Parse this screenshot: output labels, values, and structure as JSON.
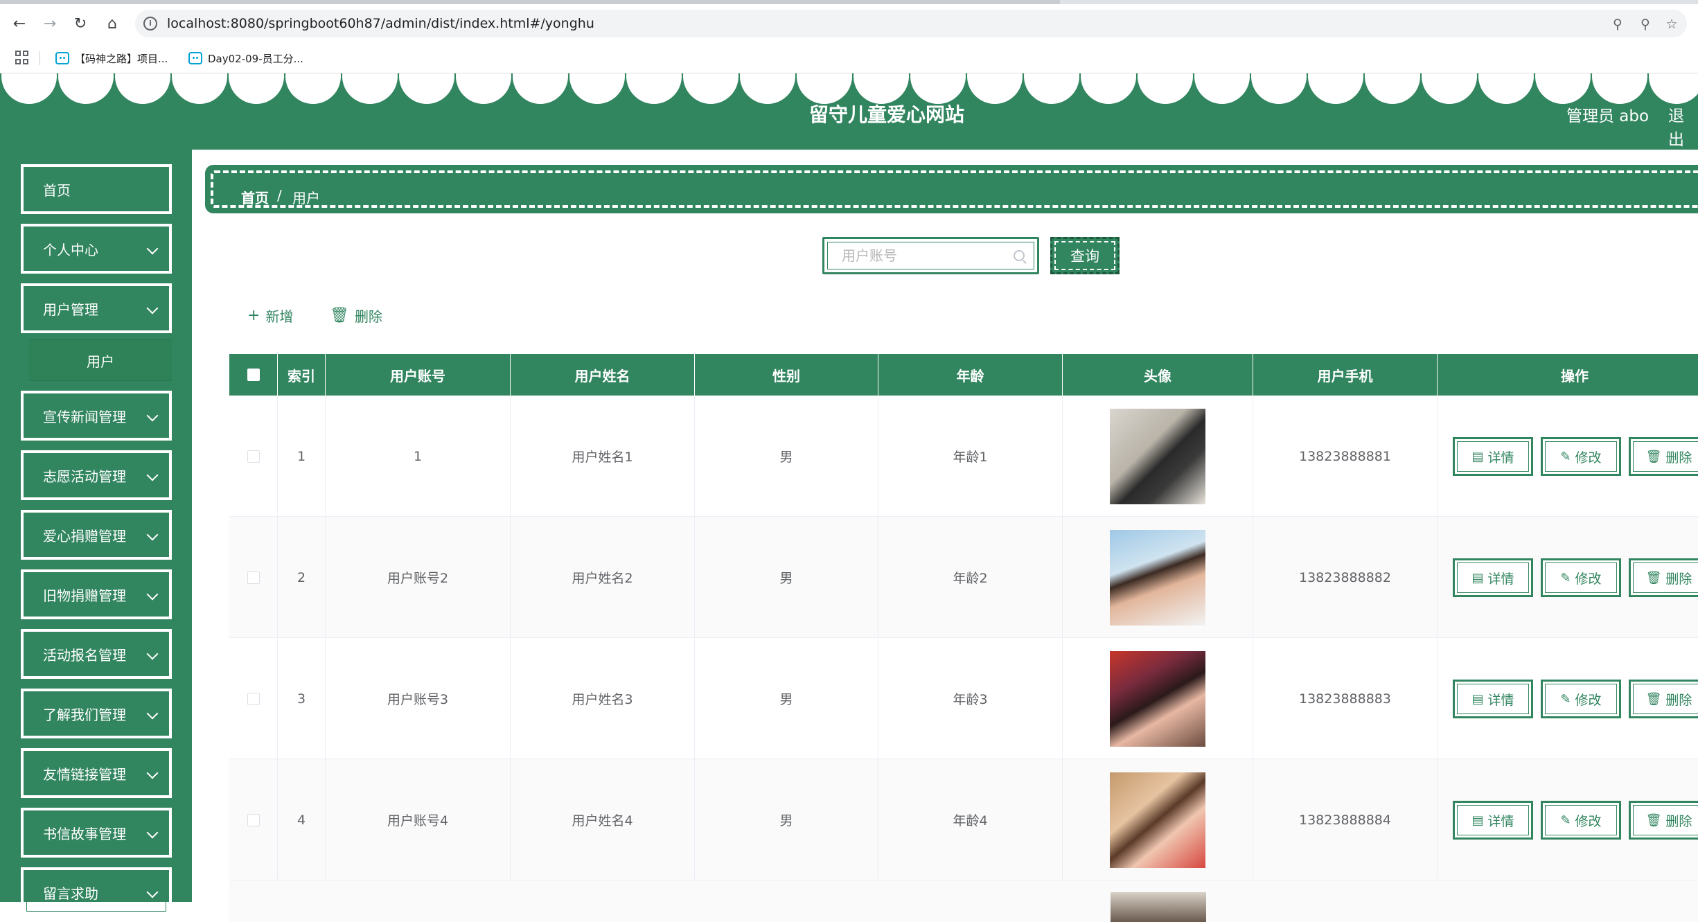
{
  "browser": {
    "url_host": "localhost",
    "url_rest": ":8080/springboot60h87/admin/dist/index.html#/yonghu",
    "bookmarks": [
      {
        "label": "【码神之路】项目..."
      },
      {
        "label": "Day02-09-员工分..."
      }
    ]
  },
  "header": {
    "title": "留守儿童爱心网站",
    "user": "管理员 abo",
    "logout": "退出"
  },
  "sidebar": {
    "items": [
      {
        "label": "首页"
      },
      {
        "label": "个人中心"
      },
      {
        "label": "用户管理"
      },
      {
        "label": "宣传新闻管理"
      },
      {
        "label": "志愿活动管理"
      },
      {
        "label": "爱心捐赠管理"
      },
      {
        "label": "旧物捐赠管理"
      },
      {
        "label": "活动报名管理"
      },
      {
        "label": "了解我们管理"
      },
      {
        "label": "友情链接管理"
      },
      {
        "label": "书信故事管理"
      },
      {
        "label": "留言求助"
      }
    ],
    "subitem": "用户"
  },
  "breadcrumb": {
    "home": "首页",
    "sep": "/",
    "current": "用户"
  },
  "search": {
    "placeholder": "用户账号",
    "button": "查询"
  },
  "toolbar": {
    "add": "新增",
    "delete": "删除"
  },
  "table": {
    "headers": [
      "索引",
      "用户账号",
      "用户姓名",
      "性别",
      "年龄",
      "头像",
      "用户手机",
      "操作"
    ],
    "rows": [
      {
        "index": "1",
        "account": "1",
        "name": "用户姓名1",
        "gender": "男",
        "age": "年龄1",
        "phone": "13823888881"
      },
      {
        "index": "2",
        "account": "用户账号2",
        "name": "用户姓名2",
        "gender": "男",
        "age": "年龄2",
        "phone": "13823888882"
      },
      {
        "index": "3",
        "account": "用户账号3",
        "name": "用户姓名3",
        "gender": "男",
        "age": "年龄3",
        "phone": "13823888883"
      },
      {
        "index": "4",
        "account": "用户账号4",
        "name": "用户姓名4",
        "gender": "男",
        "age": "年龄4",
        "phone": "13823888884"
      }
    ],
    "actions": {
      "detail": "详情",
      "edit": "修改",
      "delete": "删除"
    }
  },
  "colors": {
    "primary": "#31855f",
    "white": "#ffffff"
  }
}
